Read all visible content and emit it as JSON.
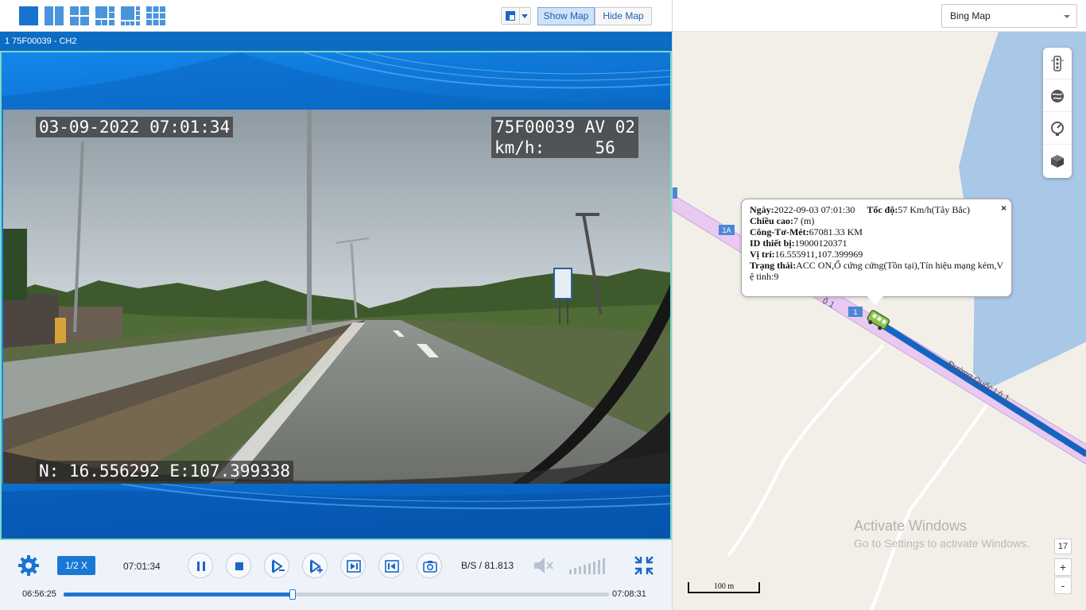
{
  "toolbar": {
    "layouts": [
      "layout-1x1-icon",
      "layout-2-icon",
      "layout-2x2-icon",
      "layout-1+5-icon",
      "layout-1+7-icon",
      "layout-3x3-icon"
    ],
    "show_map_label": "Show Map",
    "hide_map_label": "Hide Map"
  },
  "channel": {
    "title": "1  75F00039 - CH2"
  },
  "video": {
    "osd_datetime": "03-09-2022 07:01:34",
    "osd_device": "75F00039 AV 02\nkm/h:     56",
    "osd_gps": "N: 16.556292 E:107.399338"
  },
  "controls": {
    "speed_label": "1/2 X",
    "current_time": "07:01:34",
    "bitrate": "B/S / 81.813 KB/S",
    "start_time": "06:56:25",
    "end_time": "07:08:31",
    "progress_fraction": 0.42,
    "buttons": [
      "pause-icon",
      "stop-icon",
      "slower-icon",
      "faster-icon",
      "next-frame-icon",
      "prev-frame-icon",
      "camera-icon"
    ]
  },
  "map": {
    "provider": "Bing Map",
    "road_labels": {
      "r1a": "1A",
      "r1": "1",
      "road_name": "Đường Quốc Lộ 1",
      "road_fragment": "ộ 1"
    },
    "popup": {
      "close": "×",
      "date_label": "Ngày:",
      "date_value": "2022-09-03 07:01:30",
      "speed_label": "Tốc độ:",
      "speed_value": "57 Km/h(Tây Bắc)",
      "altitude_label": "Chiều cao:",
      "altitude_value": "7 (m)",
      "odometer_label": "Công-Tơ-Mét:",
      "odometer_value": "67081.33 KM",
      "device_label": "ID thiết bị:",
      "device_value": "19000120371",
      "position_label": "Vị trí:",
      "position_value": "16.555911,107.399969",
      "status_label": "Trạng thái:",
      "status_value": "ACC ON,Ổ cứng cứng(Tồn tại),Tín hiệu mạng kém,V ệ tinh:9"
    },
    "watermark_title": "Activate Windows",
    "watermark_sub": "Go to Settings to activate Windows.",
    "zoom_level": "17",
    "zoom_in": "+",
    "zoom_out": "-",
    "scale": "100 m",
    "tools": [
      "traffic-light-icon",
      "satellite-icon",
      "speed-gauge-icon",
      "cube-3d-icon"
    ],
    "colors": {
      "road_fill": "#e9c9f2",
      "route": "#1565c0",
      "water": "#a9c7e6",
      "land": "#f2efe9"
    }
  }
}
